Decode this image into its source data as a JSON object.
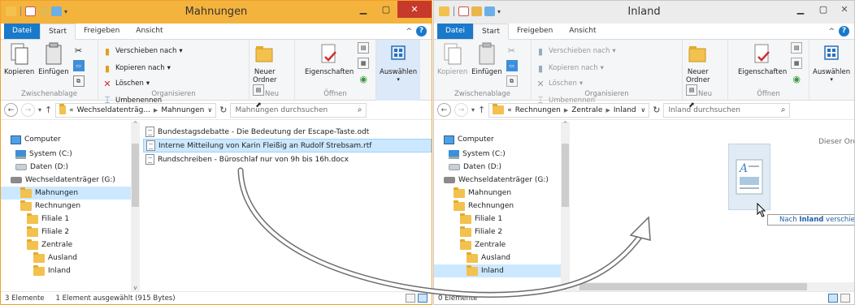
{
  "windows": {
    "left": {
      "title": "Mahnungen",
      "tabs": {
        "file": "Datei",
        "start": "Start",
        "share": "Freigeben",
        "view": "Ansicht"
      },
      "ribbon": {
        "clipboard": {
          "copy": "Kopieren",
          "paste": "Einfügen",
          "label": "Zwischenablage"
        },
        "organize": {
          "move_to": "Verschieben nach",
          "copy_to": "Kopieren nach",
          "delete": "Löschen",
          "rename": "Umbenennen",
          "label": "Organisieren"
        },
        "new": {
          "new_folder_line1": "Neuer",
          "new_folder_line2": "Ordner",
          "label": "Neu"
        },
        "open": {
          "properties": "Eigenschaften",
          "label": "Öffnen"
        },
        "select": {
          "select": "Auswählen"
        }
      },
      "address": {
        "prefix": "«",
        "crumb1": "Wechseldatenträg...",
        "crumb2": "Mahnungen"
      },
      "search_placeholder": "Mahnungen durchsuchen",
      "nav_tree": [
        {
          "label": "Computer",
          "icon": "computer-icon"
        },
        {
          "label": "System (C:)",
          "icon": "system-drive-icon"
        },
        {
          "label": "Daten (D:)",
          "icon": "drive-icon"
        },
        {
          "label": "Wechseldatenträger (G:)",
          "icon": "removable-drive-icon"
        },
        {
          "label": "Mahnungen",
          "icon": "folder-icon"
        },
        {
          "label": "Rechnungen",
          "icon": "folder-icon"
        },
        {
          "label": "Filiale 1",
          "icon": "folder-icon"
        },
        {
          "label": "Filiale 2",
          "icon": "folder-icon"
        },
        {
          "label": "Zentrale",
          "icon": "folder-icon"
        },
        {
          "label": "Ausland",
          "icon": "folder-icon"
        },
        {
          "label": "Inland",
          "icon": "folder-icon"
        }
      ],
      "files": [
        {
          "name": "Bundestagsdebatte - Die Bedeutung der Escape-Taste.odt"
        },
        {
          "name": "Interne Mitteilung von Karin Fleißig an Rudolf Strebsam.rtf"
        },
        {
          "name": "Rundschreiben - Büroschlaf nur von 9h bis 16h.docx"
        }
      ],
      "status": {
        "count": "3 Elemente",
        "selection": "1 Element ausgewählt (915 Bytes)"
      }
    },
    "right": {
      "title": "Inland",
      "tabs": {
        "file": "Datei",
        "start": "Start",
        "share": "Freigeben",
        "view": "Ansicht"
      },
      "ribbon": {
        "clipboard": {
          "copy": "Kopieren",
          "paste": "Einfügen",
          "label": "Zwischenablage"
        },
        "organize": {
          "move_to": "Verschieben nach",
          "copy_to": "Kopieren nach",
          "delete": "Löschen",
          "rename": "Umbenennen",
          "label": "Organisieren"
        },
        "new": {
          "new_folder_line1": "Neuer",
          "new_folder_line2": "Ordner",
          "label": "Neu"
        },
        "open": {
          "properties": "Eigenschaften",
          "label": "Öffnen"
        },
        "select": {
          "select": "Auswählen"
        }
      },
      "address": {
        "prefix": "«",
        "crumb1": "Rechnungen",
        "crumb2": "Zentrale",
        "crumb3": "Inland"
      },
      "search_placeholder": "Inland durchsuchen",
      "nav_tree": [
        {
          "label": "Computer",
          "icon": "computer-icon"
        },
        {
          "label": "System (C:)",
          "icon": "system-drive-icon"
        },
        {
          "label": "Daten (D:)",
          "icon": "drive-icon"
        },
        {
          "label": "Wechseldatenträger (G:)",
          "icon": "removable-drive-icon"
        },
        {
          "label": "Mahnungen",
          "icon": "folder-icon"
        },
        {
          "label": "Rechnungen",
          "icon": "folder-icon"
        },
        {
          "label": "Filiale 1",
          "icon": "folder-icon"
        },
        {
          "label": "Filiale 2",
          "icon": "folder-icon"
        },
        {
          "label": "Zentrale",
          "icon": "folder-icon"
        },
        {
          "label": "Ausland",
          "icon": "folder-icon"
        },
        {
          "label": "Inland",
          "icon": "folder-icon"
        }
      ],
      "empty_message": "Dieser Ordner ist leer.",
      "drag_tooltip": {
        "prefix": "Nach",
        "target": "Inland",
        "suffix": "verschieben"
      },
      "status": {
        "count": "0 Elemente"
      }
    }
  },
  "colors": {
    "active_title": "#f4b33d",
    "inactive_title": "#ececec",
    "accent_blue": "#1979ca",
    "selection": "#cce8ff",
    "close_red": "#c7392b",
    "folder": "#f2c14e"
  }
}
